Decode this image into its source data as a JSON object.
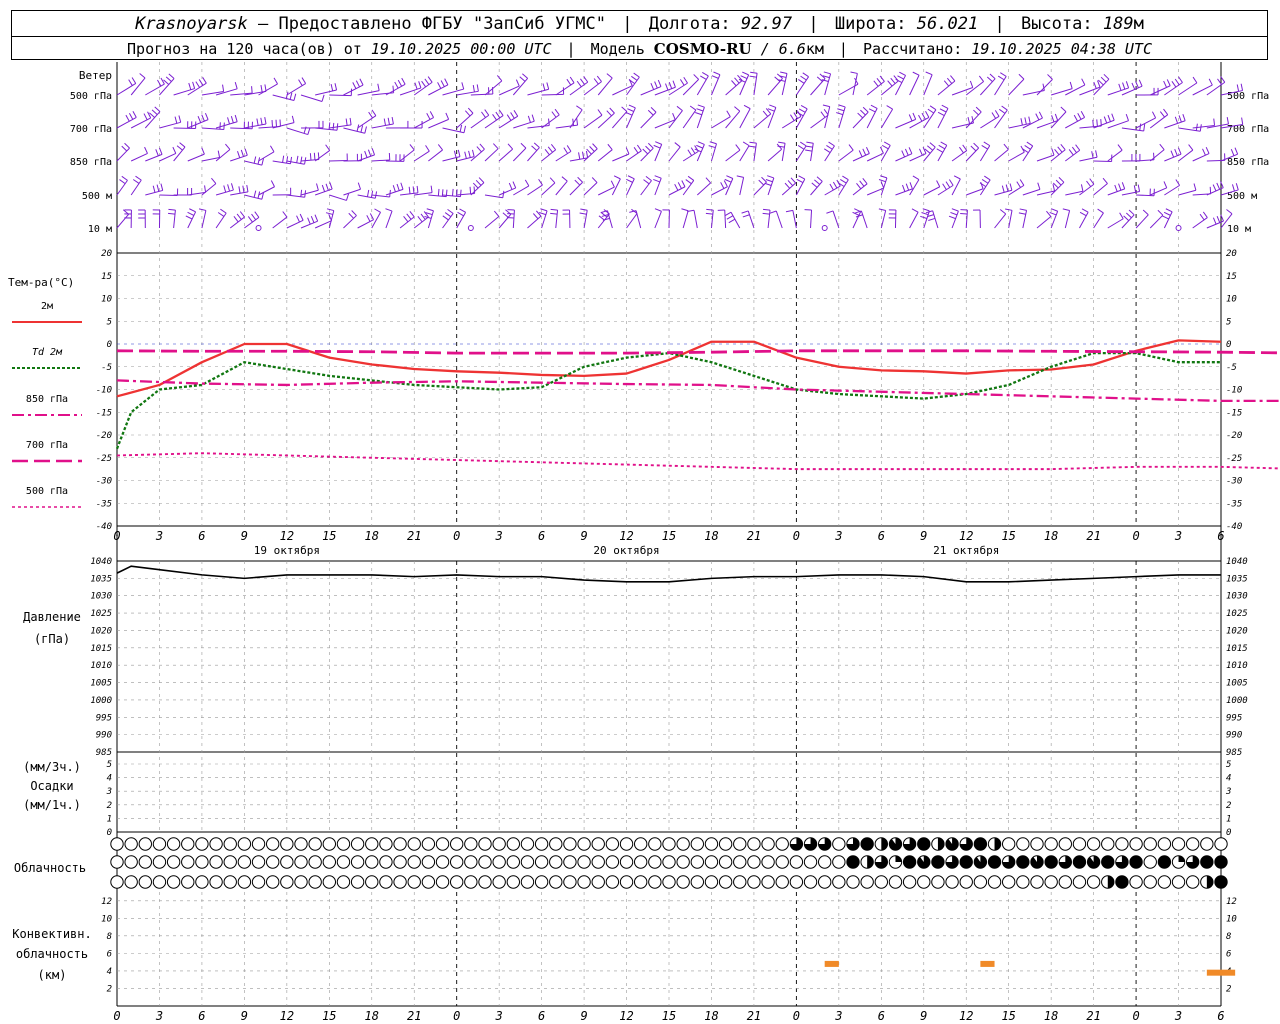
{
  "header": {
    "station": "Krasnoyarsk",
    "provided": "— Предоставлено ФГБУ \"ЗапСиб УГМС\"",
    "lon_label": "Долгота:",
    "lon": "92.97",
    "lat_label": "Широта:",
    "lat": "56.021",
    "alt_label": "Высота:",
    "alt": "189",
    "alt_unit": "м",
    "forecast_label": "Прогноз на 120 часа(ов) от",
    "forecast_start": "19.10.2025 00:00 UTC",
    "model_label": "Модель",
    "model": "COSMO-RU",
    "resolution": "/ 6.6",
    "resolution_unit": "км",
    "computed_label": "Рассчитано:",
    "computed": "19.10.2025 04:38 UTC"
  },
  "colors": {
    "wind": "#7b1fd1",
    "t2m": "#ee3333",
    "td2m": "#117711",
    "t850": "#e0108a",
    "t700": "#e0108a",
    "t500": "#e0108a",
    "pressure": "#000000",
    "convective": "#f08a28",
    "grid": "#999999"
  },
  "labels": {
    "wind": "Ветер",
    "temp": "Тем-ра(°C)",
    "pressure": [
      "Давление",
      "(гПа)"
    ],
    "precip": [
      "(мм/3ч.)",
      "Осадки",
      "(мм/1ч.)"
    ],
    "clouds": "Облачность",
    "convective": [
      "Конвективн.",
      "облачность",
      "(км)"
    ]
  },
  "wind_levels": [
    "500 гПа",
    "700 гПа",
    "850 гПа",
    "500 м",
    "10  м"
  ],
  "legend": [
    {
      "label": "2м",
      "key": "t2m"
    },
    {
      "label": "Td  2м",
      "key": "td2m"
    },
    {
      "label": "850 гПа",
      "key": "t850"
    },
    {
      "label": "700 гПа",
      "key": "t700"
    },
    {
      "label": "500 гПа",
      "key": "t500"
    }
  ],
  "time_ticks": [
    "0",
    "3",
    "6",
    "9",
    "12",
    "15",
    "18",
    "21",
    "0",
    "3",
    "6",
    "9",
    "12",
    "15",
    "18",
    "21",
    "0",
    "3",
    "6",
    "9",
    "12",
    "15",
    "18",
    "21",
    "0",
    "3",
    "6"
  ],
  "date_labels": [
    "19 октября",
    "20 октября",
    "21 октября"
  ],
  "chart_data": [
    {
      "type": "line",
      "name": "temperature",
      "x_hours": [
        0,
        6,
        9,
        12,
        18,
        21,
        24,
        30,
        33,
        36,
        39,
        42,
        48,
        51,
        54,
        57,
        60,
        66,
        69,
        72,
        75,
        78,
        81,
        84,
        87,
        90,
        93,
        96,
        99,
        102,
        105,
        108,
        111,
        114,
        117,
        120,
        123,
        126,
        129,
        132,
        135,
        138,
        141,
        144,
        147,
        150,
        153,
        156,
        159,
        162,
        165,
        168,
        171,
        174,
        177,
        180,
        183,
        186,
        189,
        192,
        195,
        198,
        201,
        204,
        207,
        210,
        213,
        216,
        219,
        222,
        225,
        228,
        231,
        234,
        237,
        240,
        243,
        246,
        249,
        252,
        255,
        258,
        261,
        264,
        267,
        270,
        273,
        276,
        279
      ],
      "ylim": [
        -40,
        20
      ],
      "yticks": [
        20,
        15,
        10,
        5,
        0,
        -5,
        -10,
        -15,
        -20,
        -25,
        -30,
        -35,
        -40
      ],
      "series": [
        {
          "name": "2м",
          "key": "t2m",
          "x": [
            0,
            3,
            6,
            9,
            12,
            15,
            18,
            21,
            24,
            27,
            30,
            33,
            36,
            39,
            42,
            45,
            48,
            51,
            54,
            57,
            60,
            63,
            66,
            69,
            72,
            75,
            78
          ],
          "values": [
            -11.5,
            -9,
            -4,
            0,
            0,
            -3,
            -4.5,
            -5.5,
            -6,
            -6.3,
            -6.8,
            -7,
            -6.5,
            -3.5,
            0.5,
            0.5,
            -3,
            -5,
            -5.8,
            -6,
            -6.5,
            -5.8,
            -5.6,
            -4.5,
            -1.5,
            0.8,
            0.5
          ]
        },
        {
          "name": "Td  2м",
          "key": "td2m",
          "x": [
            0,
            1,
            3,
            6,
            9,
            12,
            15,
            18,
            21,
            24,
            27,
            30,
            33,
            36,
            39,
            42,
            45,
            48,
            51,
            54,
            57,
            60,
            63,
            66,
            69,
            72,
            75,
            78
          ],
          "values": [
            -23,
            -15,
            -10,
            -9,
            -4,
            -5.5,
            -7,
            -8,
            -9,
            -9.5,
            -10,
            -9.5,
            -5,
            -3,
            -2,
            -4,
            -7,
            -10,
            -11,
            -11.5,
            -12,
            -11,
            -9,
            -5,
            -2,
            -2,
            -4,
            -4
          ]
        },
        {
          "name": "850 гПа",
          "key": "t850",
          "x": [
            0,
            6,
            12,
            18,
            24,
            30,
            36,
            42,
            48,
            54,
            60,
            66,
            72,
            78,
            84,
            90,
            96,
            102,
            108,
            114,
            120
          ],
          "values": [
            -8,
            -8.7,
            -9,
            -8.5,
            -8.2,
            -8.5,
            -8.8,
            -9,
            -10,
            -10.5,
            -11,
            -11.5,
            -12,
            -12.5,
            -12.5,
            -13,
            -13,
            -13.5,
            -14,
            -14.5,
            -15
          ]
        },
        {
          "name": "700 гПа",
          "key": "t700",
          "x": [
            0,
            6,
            12,
            18,
            24,
            30,
            36,
            42,
            48,
            54,
            60,
            66,
            72,
            78,
            84,
            90,
            96,
            102,
            108,
            114,
            120
          ],
          "values": [
            -1.5,
            -1.6,
            -1.6,
            -1.7,
            -2,
            -2,
            -2,
            -1.8,
            -1.5,
            -1.5,
            -1.5,
            -1.6,
            -1.7,
            -1.8,
            -2,
            -2.5,
            -3,
            -3.5,
            -4,
            -4.5,
            -5
          ]
        },
        {
          "name": "500 гПа",
          "key": "t500",
          "x": [
            0,
            6,
            12,
            18,
            24,
            30,
            36,
            42,
            48,
            54,
            60,
            66,
            72,
            78,
            84,
            90,
            96,
            102,
            108,
            114,
            120
          ],
          "values": [
            -24.5,
            -24,
            -24.5,
            -25,
            -25.5,
            -26,
            -26.5,
            -27,
            -27.5,
            -27.5,
            -27.5,
            -27.5,
            -27,
            -27,
            -27.5,
            -28,
            -28.5,
            -29.5,
            -31,
            -32.5,
            -35
          ]
        }
      ]
    },
    {
      "type": "line",
      "name": "pressure",
      "ylim": [
        985,
        1040
      ],
      "yticks": [
        1040,
        1035,
        1030,
        1025,
        1020,
        1015,
        1010,
        1005,
        1000,
        995,
        990,
        985
      ],
      "series": [
        {
          "name": "Давление",
          "key": "pressure",
          "x": [
            0,
            1,
            3,
            6,
            9,
            12,
            15,
            18,
            21,
            24,
            27,
            30,
            33,
            36,
            39,
            42,
            45,
            48,
            51,
            54,
            57,
            60,
            63,
            66,
            69,
            72,
            75,
            78
          ],
          "values": [
            1036.5,
            1038.5,
            1037.5,
            1036,
            1035,
            1036,
            1036,
            1036,
            1035.5,
            1036,
            1035.5,
            1035.5,
            1034.5,
            1034,
            1034,
            1035,
            1035.5,
            1035.5,
            1036,
            1036,
            1035.5,
            1034,
            1034,
            1034.5,
            1035,
            1035.5,
            1036,
            1036
          ]
        }
      ]
    },
    {
      "type": "bar",
      "name": "precipitation",
      "ylim": [
        0,
        5
      ],
      "yticks": [
        5,
        4,
        3,
        2,
        1,
        0
      ],
      "series": [
        {
          "name": "Осадки",
          "key": "precip",
          "x": [],
          "values": []
        }
      ]
    },
    {
      "type": "bar",
      "name": "convective",
      "ylim": [
        0,
        13
      ],
      "yticks": [
        12,
        10,
        8,
        6,
        4,
        2,
        0
      ],
      "series": [
        {
          "name": "Конвективн. облачность",
          "key": "convective",
          "x_start": [
            50,
            61,
            77
          ],
          "x_end": [
            51,
            62,
            79
          ],
          "values": [
            4.8,
            4.8,
            3.8
          ]
        }
      ]
    }
  ]
}
